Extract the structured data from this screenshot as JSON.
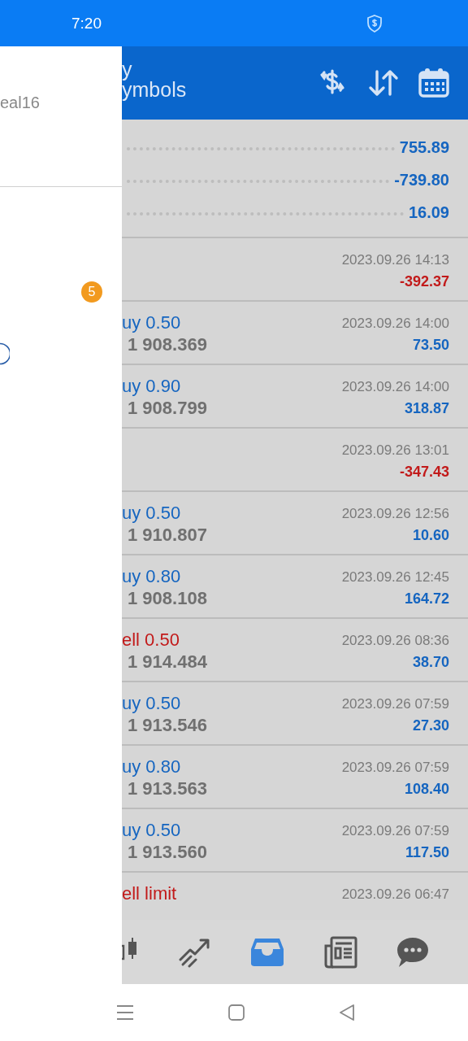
{
  "status_bar": {
    "time": "7:20"
  },
  "drawer": {
    "account_text": "eal16",
    "badge": "5"
  },
  "header": {
    "title_line_1": "y",
    "title_line_2": "ymbols"
  },
  "summary": [
    {
      "value": "755.89"
    },
    {
      "value": "-739.80"
    },
    {
      "value": "16.09"
    }
  ],
  "deals": [
    {
      "kind": "balance",
      "time": "2023.09.26 14:13",
      "profit": "-392.37",
      "loss": true
    },
    {
      "kind": "trade",
      "sell": false,
      "order": "uy 0.50",
      "price": "1 908.369",
      "time": "2023.09.26 14:00",
      "profit": "73.50",
      "loss": false
    },
    {
      "kind": "trade",
      "sell": false,
      "order": "uy 0.90",
      "price": "1 908.799",
      "time": "2023.09.26 14:00",
      "profit": "318.87",
      "loss": false
    },
    {
      "kind": "balance",
      "time": "2023.09.26 13:01",
      "profit": "-347.43",
      "loss": true
    },
    {
      "kind": "trade",
      "sell": false,
      "order": "uy 0.50",
      "price": "1 910.807",
      "time": "2023.09.26 12:56",
      "profit": "10.60",
      "loss": false
    },
    {
      "kind": "trade",
      "sell": false,
      "order": "uy 0.80",
      "price": "1 908.108",
      "time": "2023.09.26 12:45",
      "profit": "164.72",
      "loss": false
    },
    {
      "kind": "trade",
      "sell": true,
      "order": "ell 0.50",
      "price": "1 914.484",
      "time": "2023.09.26 08:36",
      "profit": "38.70",
      "loss": false
    },
    {
      "kind": "trade",
      "sell": false,
      "order": "uy 0.50",
      "price": "1 913.546",
      "time": "2023.09.26 07:59",
      "profit": "27.30",
      "loss": false
    },
    {
      "kind": "trade",
      "sell": false,
      "order": "uy 0.80",
      "price": "1 913.563",
      "time": "2023.09.26 07:59",
      "profit": "108.40",
      "loss": false
    },
    {
      "kind": "trade",
      "sell": false,
      "order": "uy 0.50",
      "price": "1 913.560",
      "time": "2023.09.26 07:59",
      "profit": "117.50",
      "loss": false
    },
    {
      "kind": "order",
      "sell": true,
      "order": "ell limit",
      "time": "2023.09.26 06:47"
    }
  ],
  "bottom_nav": [
    {
      "kind": "chart",
      "selected": false
    },
    {
      "kind": "trade",
      "selected": false
    },
    {
      "kind": "history",
      "selected": true
    },
    {
      "kind": "news",
      "selected": false
    },
    {
      "kind": "chat",
      "selected": false
    }
  ]
}
